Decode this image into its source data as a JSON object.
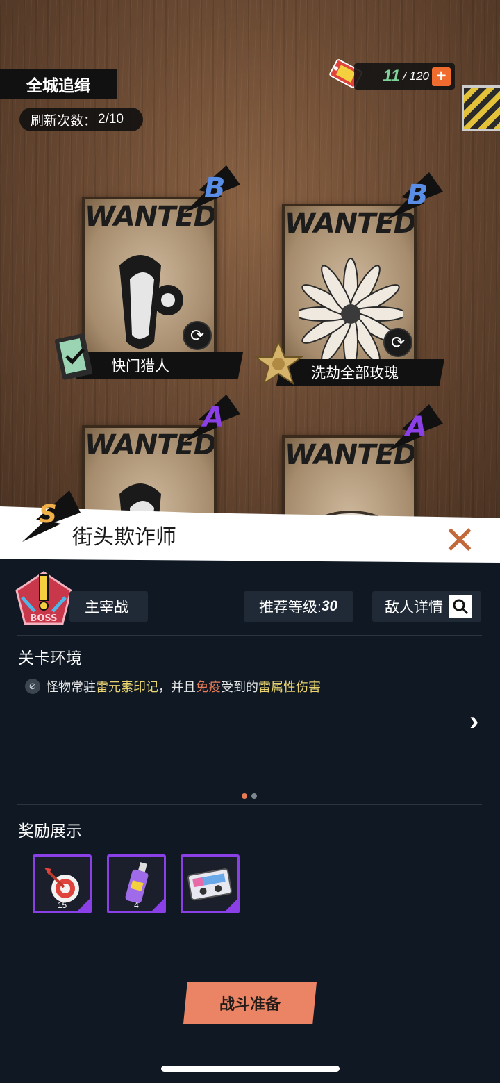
{
  "top": {
    "title": "全城追缉",
    "refresh_label": "刷新次数：",
    "refresh_value": "2/10",
    "stamina_current": "11",
    "stamina_max": "/ 120",
    "stamina_plus": "+"
  },
  "posters": [
    {
      "wanted": "WANTED",
      "rank": "B",
      "name": "快门猎人",
      "badge": "memory-film-icon"
    },
    {
      "wanted": "WANTED",
      "rank": "B",
      "name": "洗劫全部玫瑰",
      "badge": "sheriff-star-icon"
    },
    {
      "wanted": "WANTED",
      "rank": "A"
    },
    {
      "wanted": "WANTED",
      "rank": "A"
    }
  ],
  "panel": {
    "rank": "S",
    "title": "街头欺诈师",
    "close": "✕",
    "boss_tag": "主宰战",
    "recommend_label": "推荐等级:",
    "recommend_value": "30",
    "enemy_detail": "敌人详情",
    "env_title": "关卡环境",
    "env_text_1": "怪物常驻",
    "env_hl_1": "雷元素印记",
    "env_text_2": "，并且",
    "env_hl_2": "免疫",
    "env_text_3": "受到的",
    "env_hl_3": "雷属性伤害",
    "reward_title": "奖励展示",
    "rewards": [
      {
        "icon": "dart-target-icon",
        "count": "15"
      },
      {
        "icon": "spray-can-icon",
        "count": "4"
      },
      {
        "icon": "cassette-tape-icon",
        "count": ""
      }
    ],
    "battle_button": "战斗准备"
  },
  "colors": {
    "accent_orange": "#ea8464",
    "rank_b": "#5a8ee6",
    "rank_a": "#8b3fe6",
    "rank_s": "#f0b04a",
    "highlight_yellow": "#e9d46f",
    "highlight_orange": "#e57b56",
    "panel_bg": "#0f1823"
  }
}
